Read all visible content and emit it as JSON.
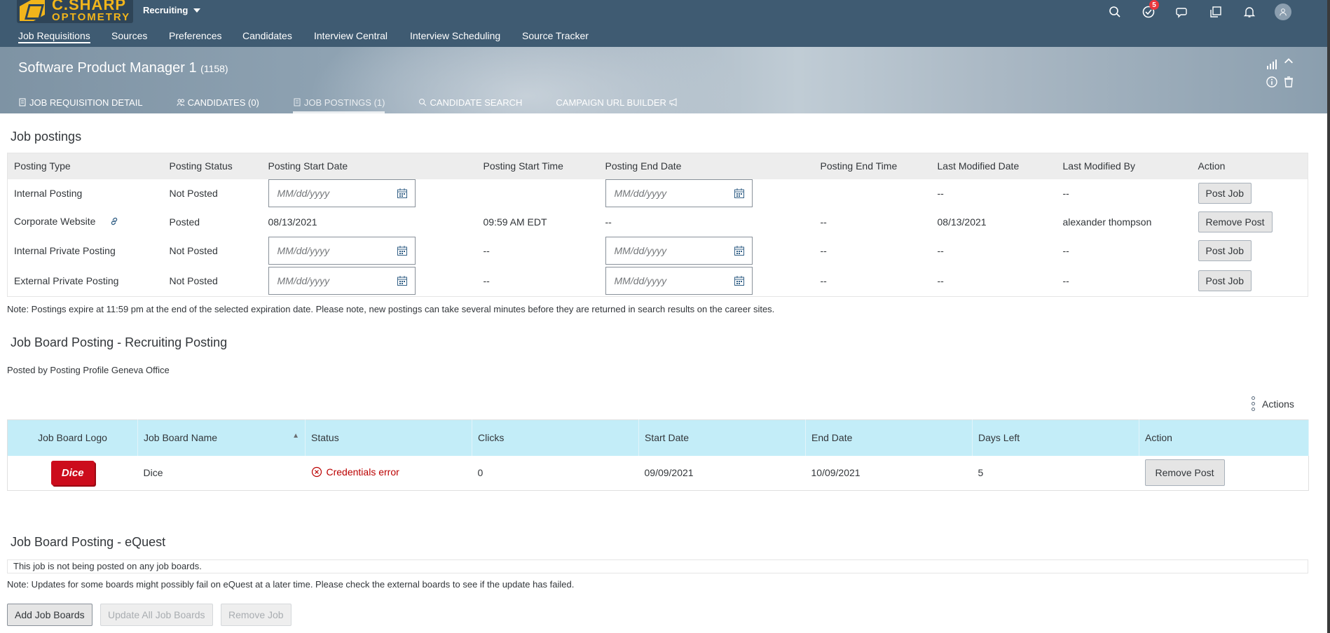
{
  "app": {
    "logo_line1": "C.SHARP",
    "logo_line2": "OPTOMETRY",
    "module": "Recruiting",
    "notification_count": "5",
    "accent": "#3f5b72"
  },
  "nav": {
    "items": [
      "Job Requisitions",
      "Sources",
      "Preferences",
      "Candidates",
      "Interview Central",
      "Interview Scheduling",
      "Source Tracker"
    ]
  },
  "header": {
    "title": "Software Product Manager 1",
    "req_id": "(1158)",
    "tabs": [
      "JOB REQUISITION DETAIL",
      "CANDIDATES (0)",
      "JOB POSTINGS (1)",
      "CANDIDATE SEARCH",
      "CAMPAIGN URL BUILDER"
    ]
  },
  "postings": {
    "title": "Job postings",
    "columns": [
      "Posting Type",
      "Posting Status",
      "Posting Start Date",
      "Posting Start Time",
      "Posting End Date",
      "Posting End Time",
      "Last Modified Date",
      "Last Modified By",
      "Action"
    ],
    "date_placeholder": "MM/dd/yyyy",
    "rows": [
      {
        "type": "Internal Posting",
        "status": "Not Posted",
        "start_time": "",
        "end_time": "",
        "modified_date": "--",
        "modified_by": "--",
        "action": "Post Job"
      },
      {
        "type": "Corporate Website",
        "status": "Posted",
        "start_date": "08/13/2021",
        "start_time": "09:59 AM EDT",
        "end_date": "--",
        "end_time": "--",
        "modified_date": "08/13/2021",
        "modified_by": "alexander thompson",
        "action": "Remove Post"
      },
      {
        "type": "Internal Private Posting",
        "status": "Not Posted",
        "start_time": "--",
        "end_time": "--",
        "modified_date": "--",
        "modified_by": "--",
        "action": "Post Job"
      },
      {
        "type": "External Private Posting",
        "status": "Not Posted",
        "start_time": "--",
        "end_time": "--",
        "modified_date": "--",
        "modified_by": "--",
        "action": "Post Job"
      }
    ],
    "note": "Note: Postings expire at 11:59 pm at the end of the selected expiration date. Please note, new postings can take several minutes before they are returned in search results on the career sites."
  },
  "job_board": {
    "title": "Job Board Posting - Recruiting Posting",
    "posted_by": "Posted by Posting Profile Geneva Office",
    "actions_label": "Actions",
    "columns": [
      "Job Board Logo",
      "Job Board Name",
      "Status",
      "Clicks",
      "Start Date",
      "End Date",
      "Days Left",
      "Action"
    ],
    "rows": [
      {
        "logo": "Dice",
        "name": "Dice",
        "status": "Credentials error",
        "clicks": "0",
        "start": "09/09/2021",
        "end": "10/09/2021",
        "days_left": "5",
        "action": "Remove Post"
      }
    ]
  },
  "equest": {
    "title": "Job Board Posting - eQuest",
    "empty": "This job is not being posted on any job boards.",
    "note": "Note: Updates for some boards might possibly fail on eQuest at a later time. Please check the external boards to see if the update has failed.",
    "buttons": [
      "Add Job Boards",
      "Update All Job Boards",
      "Remove Job"
    ]
  }
}
